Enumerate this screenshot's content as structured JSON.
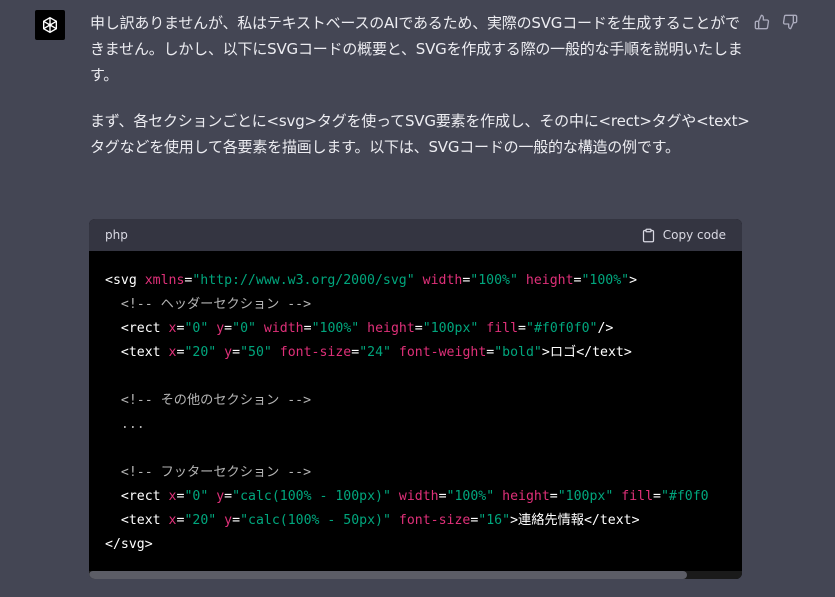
{
  "message": {
    "para1": "申し訳ありませんが、私はテキストベースのAIであるため、実際のSVGコードを生成することができません。しかし、以下にSVGコードの概要と、SVGを作成する際の一般的な手順を説明いたします。",
    "para2": "まず、各セクションごとに<svg>タグを使ってSVG要素を作成し、その中に<rect>タグや<text>タグなどを使用して各要素を描画します。以下は、SVGコードの一般的な構造の例です。"
  },
  "icons": {
    "avatar": "openai-logo-icon",
    "thumbs_up": "thumbs-up-icon",
    "thumbs_down": "thumbs-down-icon",
    "clipboard": "clipboard-icon"
  },
  "code": {
    "language": "php",
    "copy_label": "Copy code",
    "lines": [
      [
        [
          "tag",
          "<svg "
        ],
        [
          "attr",
          "xmlns"
        ],
        [
          "tag",
          "="
        ],
        [
          "val",
          "\"http://www.w3.org/2000/svg\""
        ],
        [
          "tag",
          " "
        ],
        [
          "attr",
          "width"
        ],
        [
          "tag",
          "="
        ],
        [
          "val",
          "\"100%\""
        ],
        [
          "tag",
          " "
        ],
        [
          "attr",
          "height"
        ],
        [
          "tag",
          "="
        ],
        [
          "val",
          "\"100%\""
        ],
        [
          "tag",
          ">"
        ]
      ],
      [
        [
          "tag",
          "  "
        ],
        [
          "comment",
          "<!-- ヘッダーセクション -->"
        ]
      ],
      [
        [
          "tag",
          "  <rect "
        ],
        [
          "attr",
          "x"
        ],
        [
          "tag",
          "="
        ],
        [
          "val",
          "\"0\""
        ],
        [
          "tag",
          " "
        ],
        [
          "attr",
          "y"
        ],
        [
          "tag",
          "="
        ],
        [
          "val",
          "\"0\""
        ],
        [
          "tag",
          " "
        ],
        [
          "attr",
          "width"
        ],
        [
          "tag",
          "="
        ],
        [
          "val",
          "\"100%\""
        ],
        [
          "tag",
          " "
        ],
        [
          "attr",
          "height"
        ],
        [
          "tag",
          "="
        ],
        [
          "val",
          "\"100px\""
        ],
        [
          "tag",
          " "
        ],
        [
          "attr",
          "fill"
        ],
        [
          "tag",
          "="
        ],
        [
          "val",
          "\"#f0f0f0\""
        ],
        [
          "tag",
          "/>"
        ]
      ],
      [
        [
          "tag",
          "  <text "
        ],
        [
          "attr",
          "x"
        ],
        [
          "tag",
          "="
        ],
        [
          "val",
          "\"20\""
        ],
        [
          "tag",
          " "
        ],
        [
          "attr",
          "y"
        ],
        [
          "tag",
          "="
        ],
        [
          "val",
          "\"50\""
        ],
        [
          "tag",
          " "
        ],
        [
          "attr",
          "font-size"
        ],
        [
          "tag",
          "="
        ],
        [
          "val",
          "\"24\""
        ],
        [
          "tag",
          " "
        ],
        [
          "attr",
          "font-weight"
        ],
        [
          "tag",
          "="
        ],
        [
          "val",
          "\"bold\""
        ],
        [
          "tag",
          ">"
        ],
        [
          "text",
          "ロゴ"
        ],
        [
          "tag",
          "</text>"
        ]
      ],
      [],
      [
        [
          "tag",
          "  "
        ],
        [
          "comment",
          "<!-- その他のセクション -->"
        ]
      ],
      [
        [
          "tag",
          "  "
        ],
        [
          "comment",
          "..."
        ]
      ],
      [],
      [
        [
          "tag",
          "  "
        ],
        [
          "comment",
          "<!-- フッターセクション -->"
        ]
      ],
      [
        [
          "tag",
          "  <rect "
        ],
        [
          "attr",
          "x"
        ],
        [
          "tag",
          "="
        ],
        [
          "val",
          "\"0\""
        ],
        [
          "tag",
          " "
        ],
        [
          "attr",
          "y"
        ],
        [
          "tag",
          "="
        ],
        [
          "val",
          "\"calc(100% - 100px)\""
        ],
        [
          "tag",
          " "
        ],
        [
          "attr",
          "width"
        ],
        [
          "tag",
          "="
        ],
        [
          "val",
          "\"100%\""
        ],
        [
          "tag",
          " "
        ],
        [
          "attr",
          "height"
        ],
        [
          "tag",
          "="
        ],
        [
          "val",
          "\"100px\""
        ],
        [
          "tag",
          " "
        ],
        [
          "attr",
          "fill"
        ],
        [
          "tag",
          "="
        ],
        [
          "val",
          "\"#f0f0"
        ]
      ],
      [
        [
          "tag",
          "  <text "
        ],
        [
          "attr",
          "x"
        ],
        [
          "tag",
          "="
        ],
        [
          "val",
          "\"20\""
        ],
        [
          "tag",
          " "
        ],
        [
          "attr",
          "y"
        ],
        [
          "tag",
          "="
        ],
        [
          "val",
          "\"calc(100% - 50px)\""
        ],
        [
          "tag",
          " "
        ],
        [
          "attr",
          "font-size"
        ],
        [
          "tag",
          "="
        ],
        [
          "val",
          "\"16\""
        ],
        [
          "tag",
          ">"
        ],
        [
          "text",
          "連絡先情報"
        ],
        [
          "tag",
          "</text>"
        ]
      ],
      [
        [
          "tag",
          "</svg>"
        ]
      ]
    ]
  }
}
